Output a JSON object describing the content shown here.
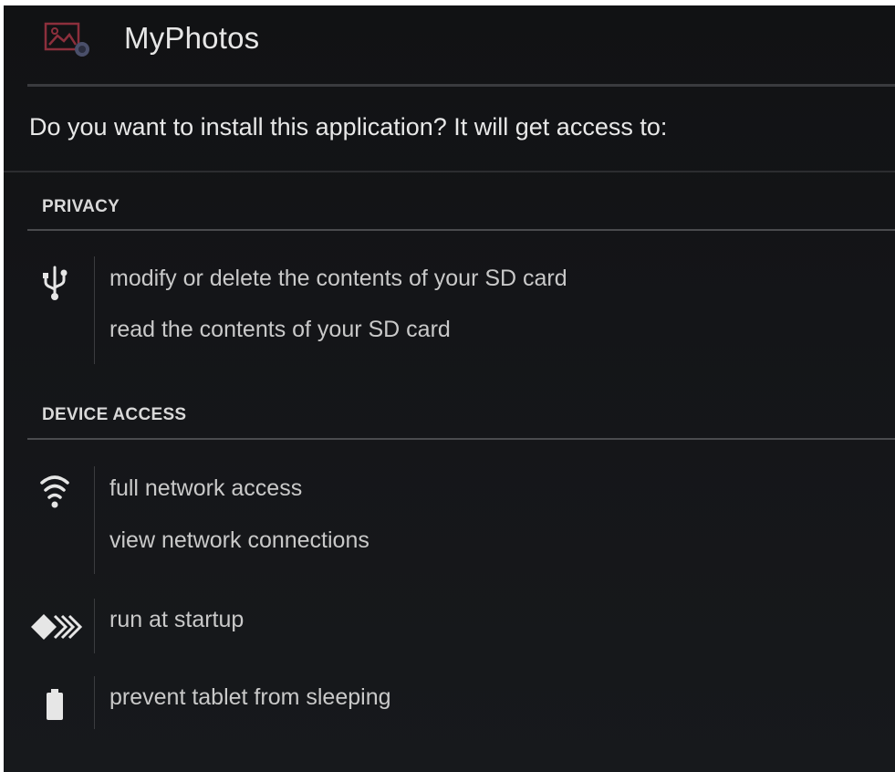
{
  "app": {
    "name": "MyPhotos",
    "icon": "image-gallery-icon"
  },
  "prompt": {
    "question": "Do you want to install this application? It will get access to:"
  },
  "sections": {
    "privacy": {
      "header": "PRIVACY",
      "groups": [
        {
          "icon": "usb-icon",
          "permissions": [
            "modify or delete the contents of your SD card",
            "read the contents of your SD card"
          ]
        }
      ]
    },
    "device_access": {
      "header": "DEVICE ACCESS",
      "groups": [
        {
          "icon": "wifi-icon",
          "permissions": [
            "full network access",
            "view network connections"
          ]
        },
        {
          "icon": "startup-arrows-icon",
          "permissions": [
            "run at startup"
          ]
        },
        {
          "icon": "battery-icon",
          "permissions": [
            "prevent tablet from sleeping"
          ]
        }
      ]
    }
  },
  "colors": {
    "background": "#141518",
    "text": "#c9c9c9",
    "rule": "#4a4b4e",
    "app_icon_accent": "#8c2f3c"
  }
}
